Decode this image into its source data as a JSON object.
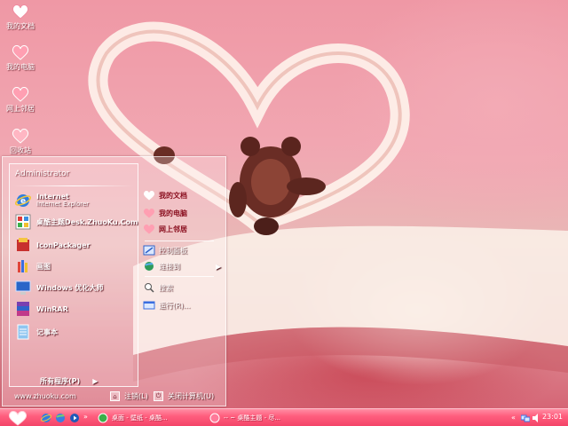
{
  "desktop": {
    "icons": [
      {
        "label": "我的文档",
        "icon": "heart-icon"
      },
      {
        "label": "我的电脑",
        "icon": "heart-icon"
      },
      {
        "label": "网上邻居",
        "icon": "heart-icon"
      },
      {
        "label": "回收站",
        "icon": "heart-icon"
      }
    ]
  },
  "start_menu": {
    "user": "Administrator",
    "pinned": [
      {
        "title": "Internet",
        "subtitle": "Internet Explorer",
        "icon": "ie-icon"
      },
      {
        "title": "桌酷主题Desk.ZhuoKu.Com",
        "icon": "zhuoku-icon"
      }
    ],
    "programs": [
      {
        "title": "IconPackager",
        "icon": "iconpackager-icon"
      },
      {
        "title": "画图",
        "icon": "paint-icon"
      },
      {
        "title": "Windows 优化大师",
        "icon": "optimizer-icon"
      },
      {
        "title": "WinRAR",
        "icon": "winrar-icon"
      },
      {
        "title": "记事本",
        "icon": "notepad-icon"
      }
    ],
    "all_programs": "所有程序(P)",
    "right": {
      "my_docs": "我的文档",
      "my_computer": "我的电脑",
      "network": "网上邻居",
      "control_panel": "控制面板",
      "connect": "连接到",
      "search": "搜索",
      "run": "运行(R)..."
    },
    "watermark": "www.zhuoku.com",
    "logoff": "注销(L)",
    "shutdown": "关闭计算机(U)"
  },
  "taskbar": {
    "tasks": [
      {
        "label": "桌面 - 壁纸 - 桌酷...",
        "icon": "green-icon"
      },
      {
        "label": "-- ~ 桌酷主题 - 尽...",
        "icon": "pink-icon"
      }
    ],
    "clock": "23:01"
  },
  "colors": {
    "taskbar": "#f44468",
    "accent_text": "#8b1020",
    "wallpaper": "#ef98a5"
  }
}
